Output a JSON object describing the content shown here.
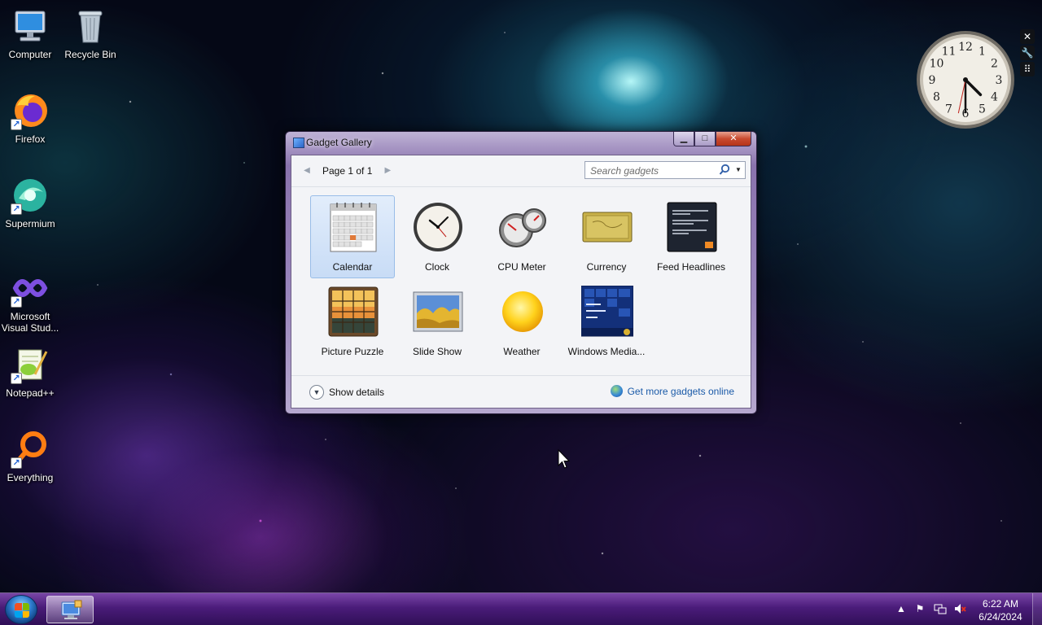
{
  "desktop": {
    "icons": [
      {
        "label": "Computer",
        "icon": "computer-icon"
      },
      {
        "label": "Recycle Bin",
        "icon": "recycle-bin-icon"
      },
      {
        "label": "Firefox",
        "icon": "firefox-icon"
      },
      {
        "label": "Supermium",
        "icon": "supermium-icon"
      },
      {
        "label": "Microsoft Visual Stud...",
        "icon": "visual-studio-icon"
      },
      {
        "label": "Notepad++",
        "icon": "notepadpp-icon"
      },
      {
        "label": "Everything",
        "icon": "everything-icon"
      }
    ]
  },
  "clock_gadget": {
    "numerals": [
      "12",
      "1",
      "2",
      "3",
      "4",
      "5",
      "6",
      "7",
      "8",
      "9",
      "10",
      "11"
    ],
    "time": {
      "hour": 4,
      "minute": 30,
      "second": 32
    }
  },
  "gallery": {
    "title": "Gadget Gallery",
    "pager": {
      "label": "Page 1 of 1"
    },
    "search": {
      "placeholder": "Search gadgets"
    },
    "gadgets": [
      {
        "name": "Calendar",
        "icon": "calendar-icon",
        "selected": true
      },
      {
        "name": "Clock",
        "icon": "clock-icon"
      },
      {
        "name": "CPU Meter",
        "icon": "cpu-meter-icon"
      },
      {
        "name": "Currency",
        "icon": "currency-icon"
      },
      {
        "name": "Feed Headlines",
        "icon": "feed-headlines-icon"
      },
      {
        "name": "Picture Puzzle",
        "icon": "picture-puzzle-icon"
      },
      {
        "name": "Slide Show",
        "icon": "slide-show-icon"
      },
      {
        "name": "Weather",
        "icon": "weather-icon"
      },
      {
        "name": "Windows Media...",
        "icon": "windows-media-icon"
      }
    ],
    "footer": {
      "show_details": "Show details",
      "get_more": "Get more gadgets online"
    }
  },
  "taskbar": {
    "clock_time": "6:22 AM",
    "clock_date": "6/24/2024"
  },
  "colors": {
    "accent": "#1a5aa8",
    "selected_tile": "#c8dcf6",
    "taskbar": "#50207f"
  }
}
